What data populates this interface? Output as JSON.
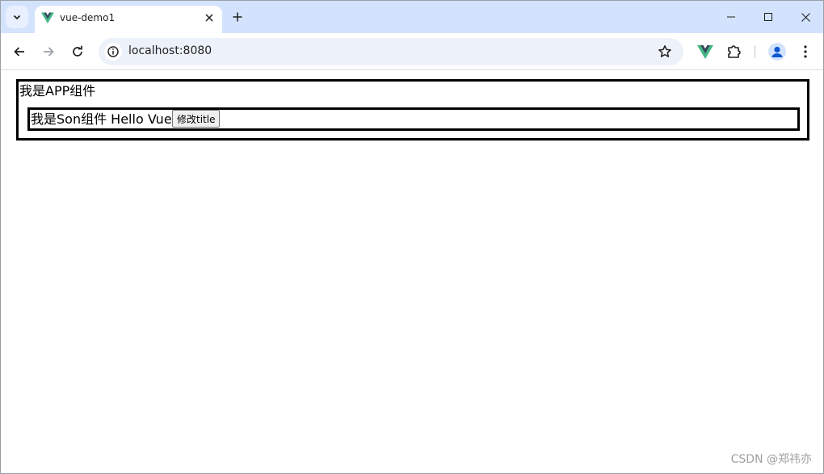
{
  "browser": {
    "tab_title": "vue-demo1",
    "url": "localhost:8080"
  },
  "page": {
    "app_text": "我是APP组件",
    "son_text": "我是Son组件 Hello Vue",
    "son_button_label": "修改title"
  },
  "watermark": "CSDN @郑祎亦",
  "colors": {
    "tab_strip": "#d3e3fd",
    "omnibox": "#edf2fa",
    "vue_green": "#41b883",
    "vue_dark": "#35495e",
    "profile_blue": "#0b57d0"
  },
  "icons": {
    "tab_search": "chevron-down-icon",
    "favicon": "vue-logo-icon",
    "tab_close": "close-icon",
    "new_tab": "plus-icon",
    "back": "arrow-left-icon",
    "forward": "arrow-right-icon",
    "reload": "reload-icon",
    "site_info": "info-icon",
    "bookmark": "star-icon",
    "extension": "puzzle-icon",
    "profile": "person-icon",
    "menu": "kebab-menu-icon"
  }
}
